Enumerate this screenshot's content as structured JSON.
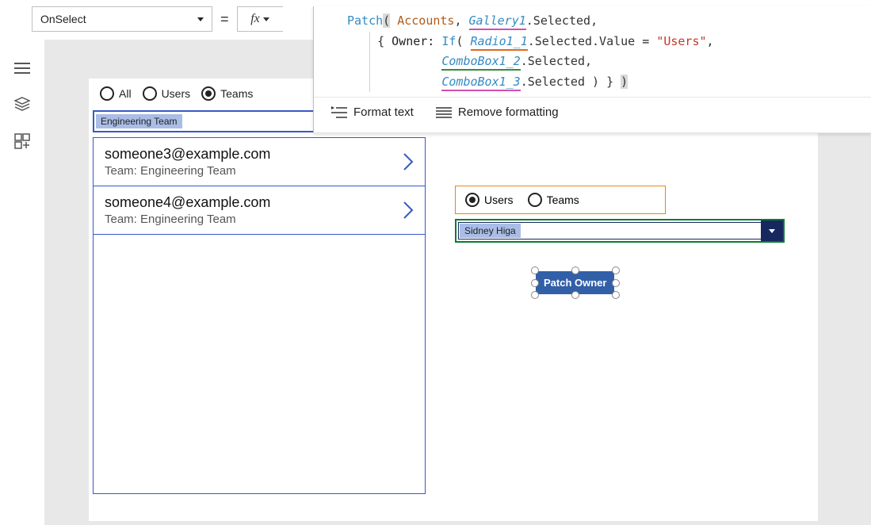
{
  "header": {
    "property": "OnSelect",
    "fx_label": "fx"
  },
  "formula": {
    "fn_patch": "Patch",
    "data_source": "Accounts",
    "gallery_ref": "Gallery1",
    "selected_prop": ".Selected",
    "owner_label": "Owner:",
    "fn_if": "If",
    "radio_ref": "Radio1_1",
    "selected_value": ".Selected.Value",
    "eq": " = ",
    "users_literal": "\"Users\"",
    "combo2_ref": "ComboBox1_2",
    "combo3_ref": "ComboBox1_3",
    "selected_prop2": ".Selected",
    "format_text_label": "Format text",
    "remove_format_label": "Remove formatting"
  },
  "left": {
    "radio": {
      "all": "All",
      "users": "Users",
      "teams": "Teams"
    },
    "team_selected": "Engineering Team",
    "gallery": [
      {
        "email": "someone3@example.com",
        "team": "Team: Engineering Team"
      },
      {
        "email": "someone4@example.com",
        "team": "Team: Engineering Team"
      }
    ]
  },
  "right": {
    "radio": {
      "users": "Users",
      "teams": "Teams"
    },
    "user_selected": "Sidney Higa",
    "button_label": "Patch Owner"
  }
}
